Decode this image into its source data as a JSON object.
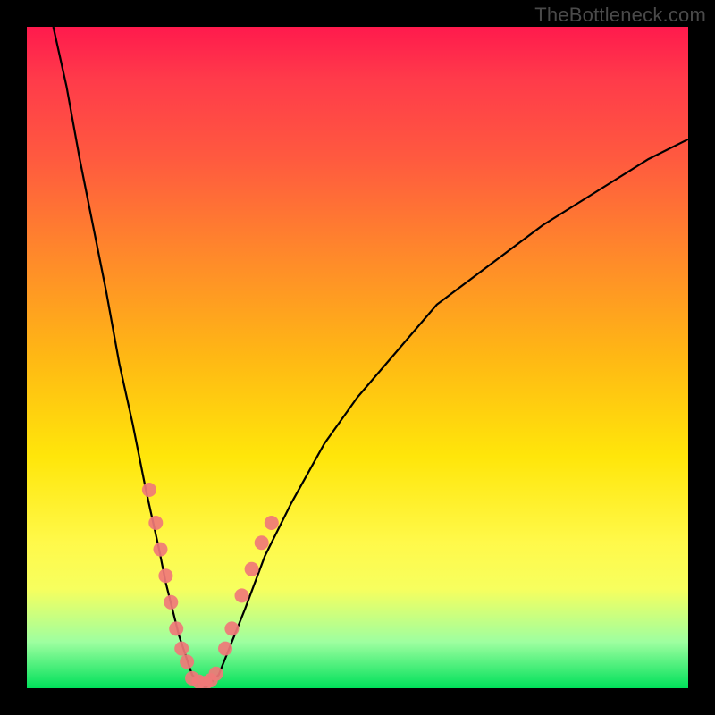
{
  "watermark": {
    "text": "TheBottleneck.com"
  },
  "colors": {
    "frame": "#000000",
    "gradient_stops": [
      {
        "pct": 0,
        "hex": "#ff1a4d"
      },
      {
        "pct": 8,
        "hex": "#ff3b4a"
      },
      {
        "pct": 20,
        "hex": "#ff5a3f"
      },
      {
        "pct": 35,
        "hex": "#ff8a2a"
      },
      {
        "pct": 50,
        "hex": "#ffb814"
      },
      {
        "pct": 65,
        "hex": "#ffe60a"
      },
      {
        "pct": 78,
        "hex": "#fff94a"
      },
      {
        "pct": 85,
        "hex": "#f7ff5e"
      },
      {
        "pct": 93,
        "hex": "#9effa0"
      },
      {
        "pct": 100,
        "hex": "#00e05a"
      }
    ],
    "dot": "#f07878",
    "curve": "#000000"
  },
  "chart_data": {
    "type": "line",
    "title": "",
    "xlabel": "",
    "ylabel": "",
    "xlim": [
      0,
      100
    ],
    "ylim": [
      0,
      100
    ],
    "series": [
      {
        "name": "bottleneck-curve-left",
        "x": [
          4,
          6,
          8,
          10,
          12,
          14,
          16,
          18,
          20,
          21,
          22,
          23,
          24,
          25,
          26,
          27
        ],
        "y": [
          100,
          91,
          80,
          70,
          60,
          49,
          40,
          30,
          21,
          16,
          12,
          8,
          5,
          2,
          1,
          0
        ]
      },
      {
        "name": "bottleneck-curve-right",
        "x": [
          27,
          29,
          31,
          33,
          36,
          40,
          45,
          50,
          56,
          62,
          70,
          78,
          86,
          94,
          100
        ],
        "y": [
          0,
          2,
          7,
          12,
          20,
          28,
          37,
          44,
          51,
          58,
          64,
          70,
          75,
          80,
          83
        ]
      }
    ],
    "points": [
      {
        "name": "dots-left-branch",
        "values": [
          {
            "x": 18.5,
            "y": 30
          },
          {
            "x": 19.5,
            "y": 25
          },
          {
            "x": 20.2,
            "y": 21
          },
          {
            "x": 21.0,
            "y": 17
          },
          {
            "x": 21.8,
            "y": 13
          },
          {
            "x": 22.6,
            "y": 9
          },
          {
            "x": 23.4,
            "y": 6
          },
          {
            "x": 24.2,
            "y": 4
          }
        ]
      },
      {
        "name": "dots-bottom-cluster",
        "values": [
          {
            "x": 25.0,
            "y": 1.5
          },
          {
            "x": 26.0,
            "y": 1.0
          },
          {
            "x": 27.0,
            "y": 0.8
          },
          {
            "x": 27.8,
            "y": 1.2
          },
          {
            "x": 28.6,
            "y": 2.2
          }
        ]
      },
      {
        "name": "dots-right-branch",
        "values": [
          {
            "x": 30.0,
            "y": 6
          },
          {
            "x": 31.0,
            "y": 9
          },
          {
            "x": 32.5,
            "y": 14
          },
          {
            "x": 34.0,
            "y": 18
          },
          {
            "x": 35.5,
            "y": 22
          },
          {
            "x": 37.0,
            "y": 25
          }
        ]
      }
    ]
  }
}
